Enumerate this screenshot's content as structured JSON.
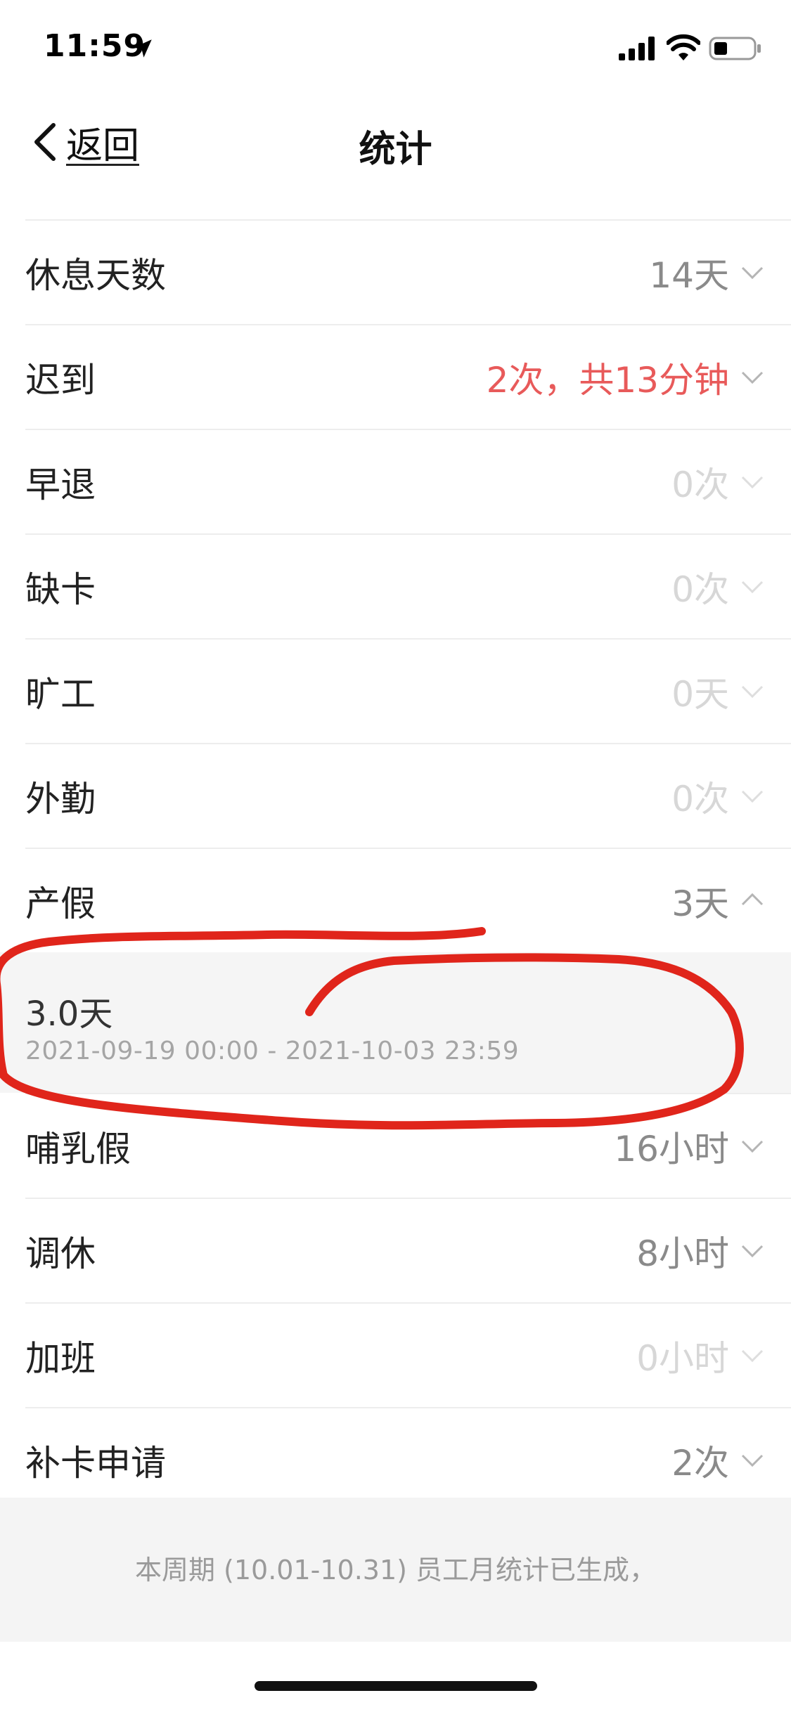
{
  "status_bar": {
    "time": "11:59"
  },
  "nav": {
    "back_label": "返回",
    "title": "统计"
  },
  "rows": [
    {
      "label": "休息天数",
      "value": "14天",
      "style": "gray",
      "expanded": false
    },
    {
      "label": "迟到",
      "value": "2次，共13分钟",
      "style": "red",
      "expanded": false
    },
    {
      "label": "早退",
      "value": "0次",
      "style": "faint",
      "expanded": false
    },
    {
      "label": "缺卡",
      "value": "0次",
      "style": "faint",
      "expanded": false
    },
    {
      "label": "旷工",
      "value": "0天",
      "style": "faint",
      "expanded": false
    },
    {
      "label": "外勤",
      "value": "0次",
      "style": "faint",
      "expanded": false
    },
    {
      "label": "产假",
      "value": "3天",
      "style": "gray",
      "expanded": true
    },
    {
      "label": "哺乳假",
      "value": "16小时",
      "style": "gray",
      "expanded": false
    },
    {
      "label": "调休",
      "value": "8小时",
      "style": "gray",
      "expanded": false
    },
    {
      "label": "加班",
      "value": "0小时",
      "style": "faint",
      "expanded": false
    },
    {
      "label": "补卡申请",
      "value": "2次",
      "style": "gray",
      "expanded": false
    }
  ],
  "maternity_detail": {
    "amount": "3.0天",
    "range": "2021-09-19 00:00 - 2021-10-03 23:59"
  },
  "footer": {
    "note": "本周期 (10.01-10.31) 员工月统计已生成，"
  },
  "colors": {
    "value_gray": "#8a8a8a",
    "value_red": "#e85a5a",
    "value_faint": "#d7d7d7",
    "annotation_red": "#e0251b"
  }
}
